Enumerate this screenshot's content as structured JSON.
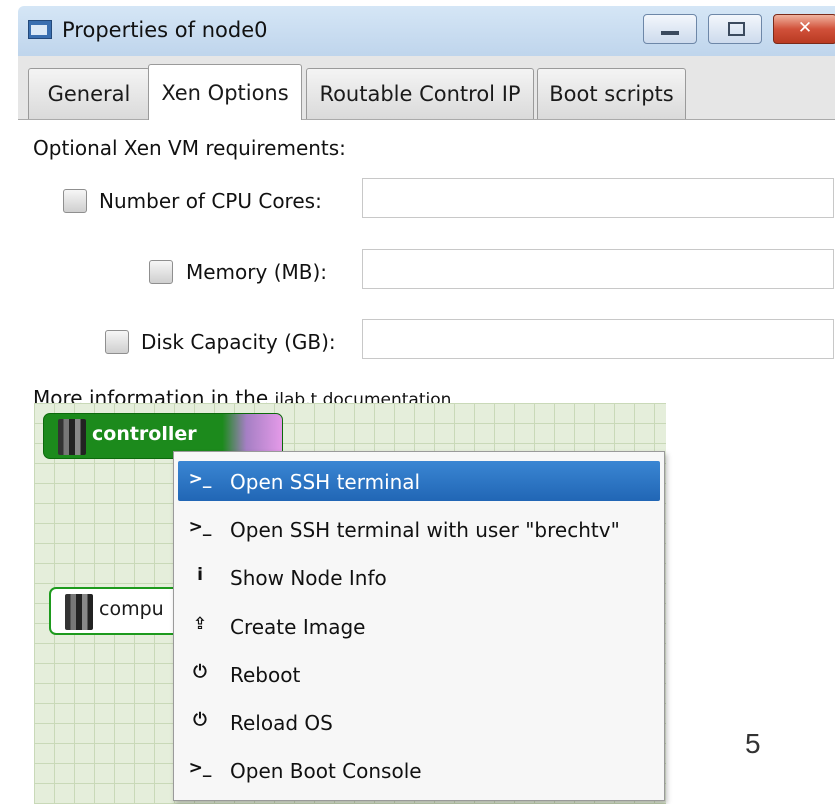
{
  "window": {
    "title": "Properties of node0",
    "controls": {
      "minimize": "minimize-button",
      "maximize": "maximize-button",
      "close": "close-button"
    }
  },
  "tabs": [
    {
      "label": "General",
      "active": false
    },
    {
      "label": "Xen Options",
      "active": true
    },
    {
      "label": "Routable Control IP",
      "active": false
    },
    {
      "label": "Boot scripts",
      "active": false
    }
  ],
  "xen_options": {
    "section_label": "Optional Xen VM requirements:",
    "rows": [
      {
        "label": "Number of CPU Cores:",
        "checked": false,
        "value": ""
      },
      {
        "label": "Memory (MB):",
        "checked": false,
        "value": ""
      },
      {
        "label": "Disk Capacity (GB):",
        "checked": false,
        "value": ""
      }
    ],
    "more_info_text": "More information in the",
    "more_info_link": "jlab.t documentation"
  },
  "canvas": {
    "nodes": [
      {
        "label": "controller",
        "icon": "server-icon"
      },
      {
        "label": "compu",
        "icon": "server-icon"
      }
    ]
  },
  "context_menu": {
    "items": [
      {
        "icon": "terminal-icon",
        "glyph": ">_",
        "label": "Open SSH terminal",
        "selected": true
      },
      {
        "icon": "terminal-icon",
        "glyph": ">_",
        "label": "Open SSH terminal with user \"brechtv\"",
        "selected": false
      },
      {
        "icon": "info-icon",
        "glyph": "i",
        "label": "Show Node Info",
        "selected": false
      },
      {
        "icon": "upload-icon",
        "glyph": "⇪",
        "label": "Create Image",
        "selected": false
      },
      {
        "icon": "power-icon",
        "glyph": "⏻",
        "label": "Reboot",
        "selected": false
      },
      {
        "icon": "power-icon",
        "glyph": "⏻",
        "label": "Reload OS",
        "selected": false
      },
      {
        "icon": "terminal-icon",
        "glyph": ">_",
        "label": "Open Boot Console",
        "selected": false
      }
    ]
  },
  "slide": {
    "page_number": "5"
  },
  "colors": {
    "menu_highlight": "#2a74c4",
    "node_green": "#1c8a1c",
    "grid_bg": "#e5eedb"
  }
}
